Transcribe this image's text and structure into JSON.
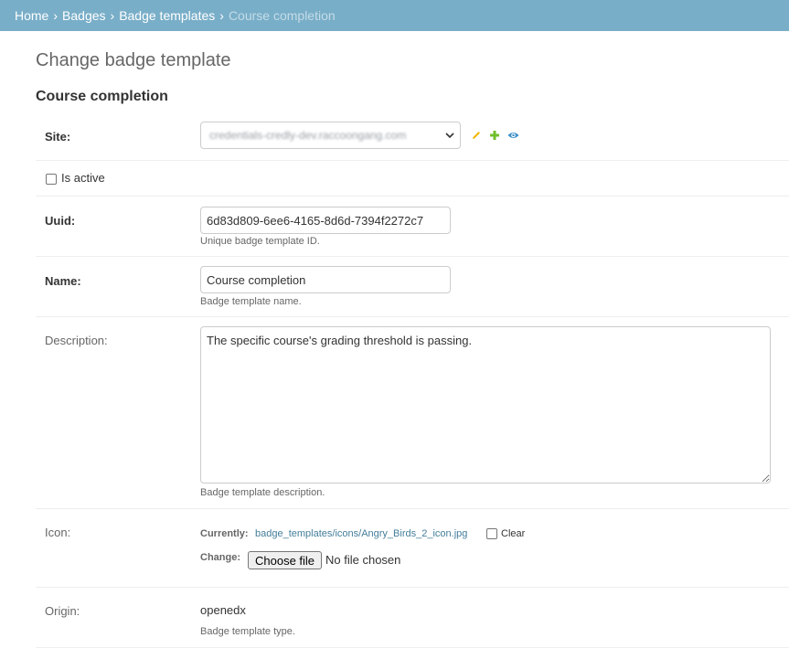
{
  "breadcrumbs": {
    "home": "Home",
    "badges": "Badges",
    "badge_templates": "Badge templates",
    "current": "Course completion",
    "separator": "›"
  },
  "page_title": "Change badge template",
  "fieldset_title": "Course completion",
  "site": {
    "label": "Site:",
    "value": "credentials-credly-dev.raccoongang.com"
  },
  "is_active": {
    "label": "Is active",
    "checked": false
  },
  "uuid": {
    "label": "Uuid:",
    "value": "6d83d809-6ee6-4165-8d6d-7394f2272c7",
    "help": "Unique badge template ID."
  },
  "name": {
    "label": "Name:",
    "value": "Course completion",
    "help": "Badge template name."
  },
  "description": {
    "label": "Description:",
    "value": "The specific course's grading threshold is passing.",
    "help": "Badge template description."
  },
  "icon": {
    "label": "Icon:",
    "currently_label": "Currently:",
    "current_file": "badge_templates/icons/Angry_Birds_2_icon.jpg",
    "clear_label": "Clear",
    "change_label": "Change:",
    "choose_file": "Choose file",
    "no_file": "No file chosen"
  },
  "origin": {
    "label": "Origin:",
    "value": "openedx",
    "help": "Badge template type."
  },
  "colors": {
    "header": "#79aec8",
    "link": "#447e9b",
    "edit_icon": "#efb80b",
    "add_icon": "#70bf2b",
    "view_icon": "#3b8fc7"
  },
  "icons": {
    "edit": "pencil-icon",
    "add": "plus-icon",
    "view": "eye-icon"
  }
}
